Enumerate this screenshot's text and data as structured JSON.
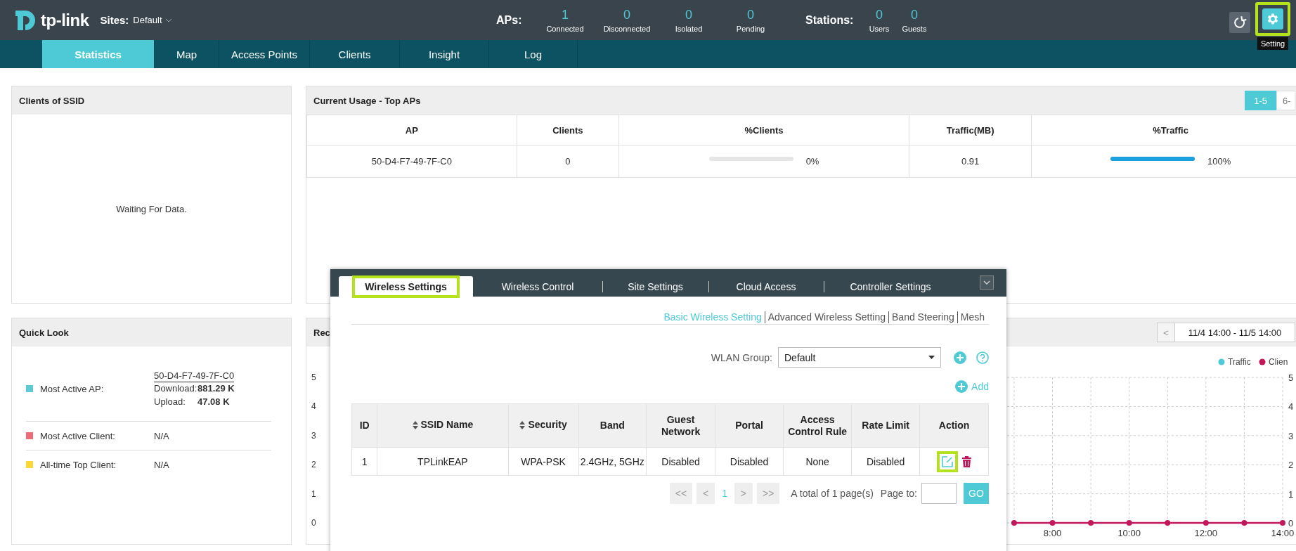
{
  "header": {
    "logo": "tp-link",
    "sites_label": "Sites:",
    "site": "Default",
    "aps_label": "APs:",
    "ap_stats": [
      {
        "value": "1",
        "label": "Connected"
      },
      {
        "value": "0",
        "label": "Disconnected"
      },
      {
        "value": "0",
        "label": "Isolated"
      },
      {
        "value": "0",
        "label": "Pending"
      }
    ],
    "stations_label": "Stations:",
    "station_stats": [
      {
        "value": "0",
        "label": "Users"
      },
      {
        "value": "0",
        "label": "Guests"
      }
    ],
    "setting": {
      "tooltip": "Setting",
      "highlighted": true
    }
  },
  "nav": [
    {
      "label": "Statistics",
      "selected": true
    },
    {
      "label": "Map",
      "selected": false
    },
    {
      "label": "Access Points",
      "selected": false
    },
    {
      "label": "Clients",
      "selected": false
    },
    {
      "label": "Insight",
      "selected": false
    },
    {
      "label": "Log",
      "selected": false
    }
  ],
  "clients_of_ssid": {
    "title": "Clients of SSID",
    "message": "Waiting For Data."
  },
  "top_aps": {
    "title": "Current Usage - Top APs",
    "pages": [
      {
        "label": "1-5",
        "selected": true
      },
      {
        "label": "6-",
        "selected": false
      }
    ],
    "columns": [
      "AP",
      "Clients",
      "%Clients",
      "Traffic(MB)",
      "%Traffic"
    ],
    "rows": [
      {
        "ap": "50-D4-F7-49-7F-C0",
        "clients": "0",
        "clients_share": {
          "level": 0,
          "reading": "0%"
        },
        "traffic": "0.91",
        "traffic_share": {
          "level": 1,
          "reading": "100%"
        }
      }
    ]
  },
  "quick_look": {
    "title": "Quick Look",
    "items": [
      {
        "kind": "ap",
        "label": "Most Active AP:",
        "color": "#5bcbd6",
        "ap": "50-D4-F7-49-7F-C0",
        "stats": [
          {
            "label": "Download:",
            "value": "881.29 K"
          },
          {
            "label": "Upload:",
            "value": "47.08 K"
          }
        ]
      },
      {
        "kind": "text",
        "label": "Most Active Client:",
        "color": "#ee6b77",
        "value": "N/A"
      },
      {
        "kind": "text",
        "label": "All-time Top Client:",
        "color": "#fdd835",
        "value": "N/A"
      }
    ]
  },
  "recent": {
    "title": "Rec",
    "range": "11/4 14:00 - 11/5 14:00",
    "prev": "<",
    "left_ticks": [
      "5",
      "4",
      "3",
      "2",
      "1",
      "0"
    ],
    "chart_data": {
      "type": "line",
      "x": [
        7,
        8,
        9,
        10,
        11,
        12,
        13,
        14
      ],
      "xticks": [
        {
          "value": 8,
          "label": "8:00"
        },
        {
          "value": 10,
          "label": "10:00"
        },
        {
          "value": 12,
          "label": "12:00"
        },
        {
          "value": 14,
          "label": "14:00"
        }
      ],
      "xlim": [
        -10,
        14
      ],
      "ylim": [
        0,
        5
      ],
      "yticks": [
        0,
        1,
        2,
        3,
        4,
        5
      ],
      "grid": true,
      "series": [
        {
          "name": "Traffic",
          "color": "#4ecad6",
          "values": [
            null,
            null,
            null,
            null,
            null,
            null,
            null,
            null
          ]
        },
        {
          "name": "Clien",
          "color": "#c2185b",
          "marker": true,
          "values": [
            0,
            0,
            0,
            0,
            0,
            0,
            0,
            0
          ]
        }
      ]
    }
  },
  "dialog": {
    "tabs": [
      {
        "label": "Wireless Settings",
        "selected": true,
        "highlighted": true
      },
      {
        "label": "Wireless Control",
        "selected": false,
        "highlighted": false
      },
      {
        "label": "Site Settings",
        "selected": false,
        "highlighted": false
      },
      {
        "label": "Cloud Access",
        "selected": false,
        "highlighted": false
      },
      {
        "label": "Controller Settings",
        "selected": false,
        "highlighted": false
      }
    ],
    "subtabs": [
      {
        "label": "Basic Wireless Setting",
        "selected": true
      },
      {
        "label": "Advanced Wireless Setting",
        "selected": false
      },
      {
        "label": "Band Steering",
        "selected": false
      },
      {
        "label": "Mesh",
        "selected": false
      }
    ],
    "wlan_group": {
      "label": "WLAN Group:",
      "value": "Default"
    },
    "add_label": "Add",
    "columns": [
      {
        "label": "ID",
        "sortable": false
      },
      {
        "label": "SSID Name",
        "sortable": true
      },
      {
        "label": "Security",
        "sortable": true
      },
      {
        "label": "Band",
        "sortable": false
      },
      {
        "label": "Guest Network",
        "sortable": false
      },
      {
        "label": "Portal",
        "sortable": false
      },
      {
        "label": "Access Control Rule",
        "sortable": false
      },
      {
        "label": "Rate Limit",
        "sortable": false
      },
      {
        "label": "Action",
        "sortable": false
      }
    ],
    "rows": [
      {
        "cells": [
          "1",
          "TPLinkEAP",
          "WPA-PSK",
          "2.4GHz, 5GHz",
          "Disabled",
          "Disabled",
          "None",
          "Disabled"
        ],
        "edit_highlighted": true
      }
    ],
    "pagination": {
      "first": "<<",
      "prev": "<",
      "current": "1",
      "next": ">",
      "last": ">>",
      "summary": "A total of 1 page(s)",
      "page_to_label": "Page to:",
      "go": "GO"
    }
  }
}
